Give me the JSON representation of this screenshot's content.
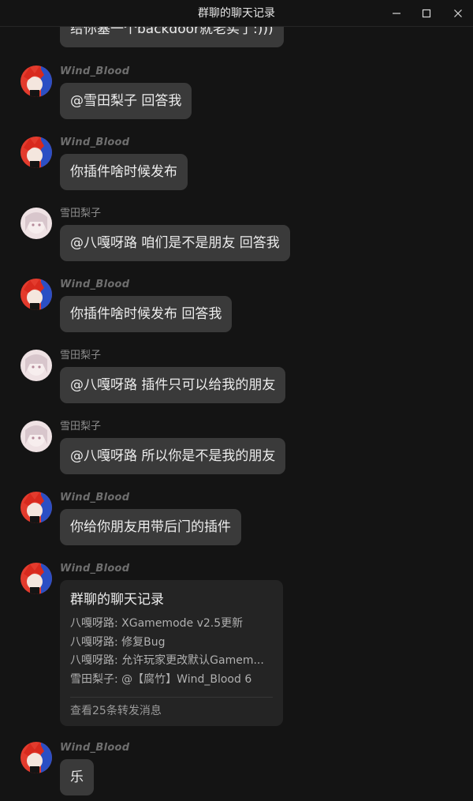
{
  "window": {
    "title": "群聊的聊天记录",
    "minimize_icon": "minimize-icon",
    "maximize_icon": "maximize-icon",
    "close_icon": "close-icon"
  },
  "messages": [
    {
      "sender": "",
      "text": "给你塞一个backdoor就老实了:)))"
    },
    {
      "sender": "Wind_Blood",
      "text": "@雪田梨子 回答我"
    },
    {
      "sender": "Wind_Blood",
      "text": "你插件啥时候发布"
    },
    {
      "sender": "雪田梨子",
      "text": "@八嘎呀路 咱们是不是朋友 回答我"
    },
    {
      "sender": "Wind_Blood",
      "text": "你插件啥时候发布 回答我"
    },
    {
      "sender": "雪田梨子",
      "text": "@八嘎呀路 插件只可以给我的朋友"
    },
    {
      "sender": "雪田梨子",
      "text": "@八嘎呀路 所以你是不是我的朋友"
    },
    {
      "sender": "Wind_Blood",
      "text": "你给你朋友用带后门的插件"
    },
    {
      "sender": "Wind_Blood",
      "text": "乐"
    }
  ],
  "forward_card": {
    "sender": "Wind_Blood",
    "title": "群聊的聊天记录",
    "lines": [
      "八嘎呀路: XGamemode v2.5更新",
      "八嘎呀路: 修复Bug",
      "八嘎呀路: 允许玩家更改默认Gamem...",
      "雪田梨子: @【腐竹】Wind_Blood 6"
    ],
    "footer": "查看25条转发消息"
  },
  "colors": {
    "background": "#141414",
    "bubble": "#3a3a3a",
    "card": "#242424"
  }
}
